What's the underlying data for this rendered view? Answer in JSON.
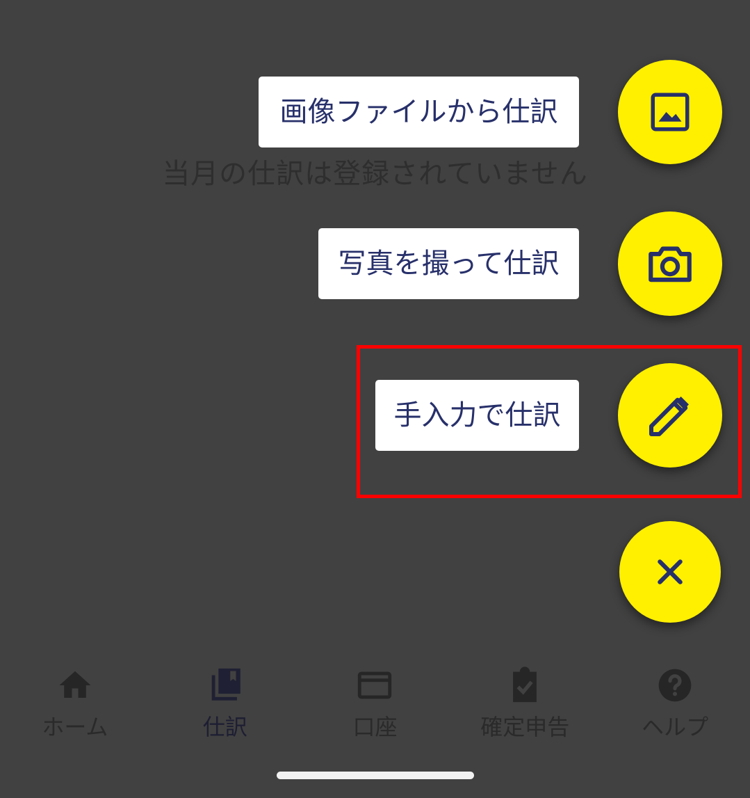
{
  "screen": {
    "empty_message": "当月の仕訳は登録されていません"
  },
  "fab_menu": {
    "items": [
      {
        "label": "画像ファイルから仕訳",
        "icon": "image-icon"
      },
      {
        "label": "写真を撮って仕訳",
        "icon": "camera-icon"
      },
      {
        "label": "手入力で仕訳",
        "icon": "pencil-icon"
      }
    ],
    "close_icon": "close-icon"
  },
  "bottom_nav": {
    "items": [
      {
        "label": "ホーム",
        "icon": "home-icon"
      },
      {
        "label": "仕訳",
        "icon": "journal-icon",
        "active": true
      },
      {
        "label": "口座",
        "icon": "credit-card-icon"
      },
      {
        "label": "確定申告",
        "icon": "clipboard-check-icon"
      },
      {
        "label": "ヘルプ",
        "icon": "help-icon"
      }
    ]
  },
  "colors": {
    "overlay_background": "#414141",
    "fab_yellow": "#fff000",
    "icon_navy": "#27306a",
    "highlight_red": "#ff0000"
  }
}
